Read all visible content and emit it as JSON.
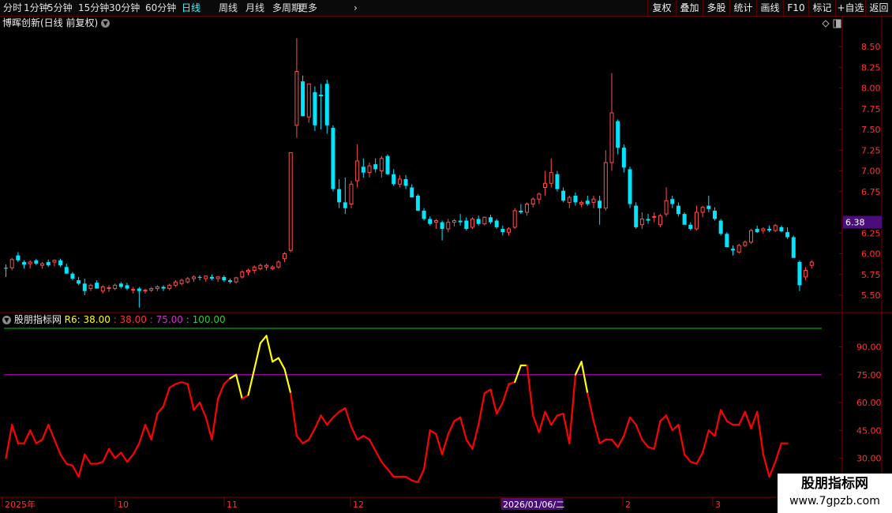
{
  "toolbar": {
    "periods": [
      "分时",
      "1分钟",
      "5分钟",
      "15分钟",
      "30分钟",
      "60分钟",
      "日线",
      "周线",
      "月线",
      "多周期",
      "更多"
    ],
    "active_period": "日线",
    "actions": [
      "复权",
      "叠加",
      "多股",
      "统计",
      "画线",
      "F10",
      "标记",
      "+自选",
      "返回"
    ]
  },
  "main_chart": {
    "title": "博晖创新(日线 前复权)",
    "price_ticks": [
      "8.50",
      "8.25",
      "8.00",
      "7.75",
      "7.50",
      "7.25",
      "7.00",
      "6.75",
      "6.25",
      "6.00",
      "5.75",
      "5.50"
    ],
    "current_price_label": "6.38"
  },
  "indicator": {
    "name": "股朋指标网",
    "params": [
      "R6: 38.00",
      ": 38.00",
      ": 75.00",
      ": 100.00"
    ],
    "ticks": [
      "90.00",
      "75.00",
      "60.00",
      "45.00",
      "30.00"
    ]
  },
  "time_axis": {
    "labels": [
      "2025年",
      "10",
      "11",
      "12",
      "2026/01/06/二",
      "2",
      "3"
    ]
  },
  "brand": {
    "line1": "股朋指标网",
    "line2": "www.7gpzb.com"
  },
  "colors": {
    "up": "#ff4d4d",
    "down": "#00e5ff",
    "indicator_line": "#ff0000",
    "indicator_high": "#ffff00",
    "line_100": "#00cc00",
    "line_75": "#cc00cc",
    "grid_border": "#800000"
  },
  "chart_data": {
    "type": "candlestick",
    "ohlc": [
      [
        5.83,
        5.87,
        5.72,
        5.82
      ],
      [
        5.83,
        5.95,
        5.8,
        5.93
      ],
      [
        5.98,
        6.02,
        5.9,
        5.92
      ],
      [
        5.9,
        5.92,
        5.82,
        5.87
      ],
      [
        5.88,
        5.92,
        5.82,
        5.9
      ],
      [
        5.92,
        5.94,
        5.86,
        5.88
      ],
      [
        5.86,
        5.9,
        5.82,
        5.88
      ],
      [
        5.9,
        5.93,
        5.84,
        5.86
      ],
      [
        5.9,
        5.93,
        5.85,
        5.92
      ],
      [
        5.92,
        5.94,
        5.84,
        5.86
      ],
      [
        5.84,
        5.88,
        5.76,
        5.76
      ],
      [
        5.76,
        5.78,
        5.68,
        5.7
      ],
      [
        5.68,
        5.72,
        5.62,
        5.64
      ],
      [
        5.64,
        5.7,
        5.5,
        5.55
      ],
      [
        5.58,
        5.64,
        5.55,
        5.62
      ],
      [
        5.65,
        5.68,
        5.58,
        5.58
      ],
      [
        5.55,
        5.62,
        5.52,
        5.6
      ],
      [
        5.58,
        5.62,
        5.54,
        5.59
      ],
      [
        5.58,
        5.64,
        5.56,
        5.62
      ],
      [
        5.64,
        5.66,
        5.58,
        5.6
      ],
      [
        5.62,
        5.65,
        5.56,
        5.58
      ],
      [
        5.56,
        5.6,
        5.52,
        5.57
      ],
      [
        5.58,
        5.6,
        5.35,
        5.55
      ],
      [
        5.55,
        5.58,
        5.52,
        5.56
      ],
      [
        5.56,
        5.6,
        5.54,
        5.58
      ],
      [
        5.58,
        5.62,
        5.55,
        5.6
      ],
      [
        5.6,
        5.62,
        5.55,
        5.58
      ],
      [
        5.58,
        5.64,
        5.56,
        5.62
      ],
      [
        5.62,
        5.68,
        5.6,
        5.66
      ],
      [
        5.64,
        5.7,
        5.62,
        5.68
      ],
      [
        5.66,
        5.72,
        5.64,
        5.7
      ],
      [
        5.7,
        5.74,
        5.66,
        5.72
      ],
      [
        5.72,
        5.74,
        5.68,
        5.71
      ],
      [
        5.7,
        5.74,
        5.66,
        5.73
      ],
      [
        5.72,
        5.75,
        5.68,
        5.7
      ],
      [
        5.7,
        5.73,
        5.66,
        5.72
      ],
      [
        5.72,
        5.74,
        5.66,
        5.68
      ],
      [
        5.68,
        5.7,
        5.64,
        5.66
      ],
      [
        5.66,
        5.72,
        5.64,
        5.71
      ],
      [
        5.72,
        5.8,
        5.7,
        5.78
      ],
      [
        5.78,
        5.82,
        5.74,
        5.8
      ],
      [
        5.8,
        5.86,
        5.76,
        5.84
      ],
      [
        5.82,
        5.88,
        5.8,
        5.86
      ],
      [
        5.84,
        5.88,
        5.8,
        5.86
      ],
      [
        5.82,
        5.86,
        5.8,
        5.84
      ],
      [
        5.84,
        5.92,
        5.82,
        5.9
      ],
      [
        5.94,
        6.02,
        5.9,
        6.0
      ],
      [
        6.04,
        7.22,
        6.02,
        7.22
      ],
      [
        7.55,
        8.6,
        7.4,
        8.2
      ],
      [
        8.08,
        8.15,
        7.66,
        7.66
      ],
      [
        7.65,
        8.05,
        7.58,
        8.05
      ],
      [
        7.95,
        8.02,
        7.48,
        7.55
      ],
      [
        7.92,
        8.05,
        7.5,
        7.9
      ],
      [
        8.05,
        8.1,
        7.45,
        7.55
      ],
      [
        7.52,
        7.55,
        6.75,
        6.78
      ],
      [
        6.78,
        6.9,
        6.55,
        6.62
      ],
      [
        6.62,
        6.92,
        6.48,
        6.55
      ],
      [
        6.6,
        6.88,
        6.55,
        6.84
      ],
      [
        6.88,
        7.32,
        6.8,
        7.12
      ],
      [
        7.05,
        7.15,
        6.92,
        6.98
      ],
      [
        6.98,
        7.1,
        6.92,
        7.06
      ],
      [
        7.08,
        7.15,
        6.98,
        7.02
      ],
      [
        7.0,
        7.18,
        6.92,
        7.15
      ],
      [
        7.18,
        7.2,
        6.95,
        6.96
      ],
      [
        6.96,
        7.02,
        6.82,
        6.84
      ],
      [
        6.84,
        6.95,
        6.8,
        6.9
      ],
      [
        6.9,
        6.95,
        6.78,
        6.82
      ],
      [
        6.8,
        6.84,
        6.68,
        6.68
      ],
      [
        6.7,
        6.72,
        6.52,
        6.52
      ],
      [
        6.52,
        6.55,
        6.4,
        6.42
      ],
      [
        6.42,
        6.45,
        6.34,
        6.36
      ],
      [
        6.38,
        6.42,
        6.3,
        6.4
      ],
      [
        6.38,
        6.4,
        6.16,
        6.3
      ],
      [
        6.3,
        6.42,
        6.26,
        6.38
      ],
      [
        6.38,
        6.42,
        6.33,
        6.4
      ],
      [
        6.4,
        6.48,
        6.34,
        6.38
      ],
      [
        6.4,
        6.44,
        6.28,
        6.3
      ],
      [
        6.32,
        6.44,
        6.3,
        6.42
      ],
      [
        6.42,
        6.46,
        6.34,
        6.36
      ],
      [
        6.36,
        6.45,
        6.34,
        6.44
      ],
      [
        6.44,
        6.47,
        6.36,
        6.38
      ],
      [
        6.4,
        6.42,
        6.3,
        6.32
      ],
      [
        6.3,
        6.34,
        6.22,
        6.26
      ],
      [
        6.26,
        6.32,
        6.22,
        6.3
      ],
      [
        6.32,
        6.55,
        6.3,
        6.52
      ],
      [
        6.52,
        6.6,
        6.48,
        6.5
      ],
      [
        6.5,
        6.62,
        6.46,
        6.6
      ],
      [
        6.6,
        6.68,
        6.56,
        6.66
      ],
      [
        6.66,
        6.74,
        6.6,
        6.72
      ],
      [
        6.8,
        7.0,
        6.7,
        6.85
      ],
      [
        6.85,
        7.15,
        6.8,
        6.98
      ],
      [
        6.96,
        7.0,
        6.75,
        6.78
      ],
      [
        6.76,
        6.8,
        6.62,
        6.64
      ],
      [
        6.62,
        6.7,
        6.55,
        6.68
      ],
      [
        6.7,
        6.74,
        6.58,
        6.62
      ],
      [
        6.6,
        6.64,
        6.56,
        6.62
      ],
      [
        6.64,
        6.7,
        6.58,
        6.6
      ],
      [
        6.62,
        6.7,
        6.55,
        6.66
      ],
      [
        6.64,
        6.7,
        6.35,
        6.55
      ],
      [
        6.55,
        7.25,
        6.52,
        7.1
      ],
      [
        7.1,
        8.18,
        7.0,
        7.7
      ],
      [
        7.6,
        7.62,
        7.2,
        7.28
      ],
      [
        7.28,
        7.32,
        6.98,
        7.04
      ],
      [
        7.02,
        7.05,
        6.55,
        6.6
      ],
      [
        6.58,
        6.62,
        6.3,
        6.32
      ],
      [
        6.35,
        6.5,
        6.3,
        6.42
      ],
      [
        6.42,
        6.48,
        6.36,
        6.4
      ],
      [
        6.44,
        6.5,
        6.38,
        6.45
      ],
      [
        6.35,
        6.48,
        6.32,
        6.46
      ],
      [
        6.48,
        6.8,
        6.45,
        6.64
      ],
      [
        6.66,
        6.7,
        6.55,
        6.6
      ],
      [
        6.58,
        6.62,
        6.45,
        6.48
      ],
      [
        6.48,
        6.5,
        6.35,
        6.35
      ],
      [
        6.35,
        6.38,
        6.28,
        6.3
      ],
      [
        6.3,
        6.58,
        6.28,
        6.5
      ],
      [
        6.5,
        6.58,
        6.44,
        6.56
      ],
      [
        6.58,
        6.7,
        6.5,
        6.54
      ],
      [
        6.52,
        6.56,
        6.4,
        6.42
      ],
      [
        6.4,
        6.42,
        6.22,
        6.24
      ],
      [
        6.24,
        6.26,
        6.08,
        6.08
      ],
      [
        6.06,
        6.1,
        5.98,
        6.04
      ],
      [
        6.02,
        6.12,
        6.0,
        6.1
      ],
      [
        6.1,
        6.16,
        6.08,
        6.14
      ],
      [
        6.14,
        6.3,
        6.12,
        6.28
      ],
      [
        6.3,
        6.34,
        6.25,
        6.26
      ],
      [
        6.28,
        6.32,
        6.24,
        6.3
      ],
      [
        6.3,
        6.34,
        6.26,
        6.28
      ],
      [
        6.28,
        6.36,
        6.26,
        6.34
      ],
      [
        6.32,
        6.34,
        6.26,
        6.27
      ],
      [
        6.26,
        6.32,
        6.18,
        6.2
      ],
      [
        6.2,
        6.22,
        5.95,
        5.95
      ],
      [
        5.9,
        5.92,
        5.55,
        5.62
      ],
      [
        5.72,
        5.84,
        5.68,
        5.8
      ],
      [
        5.86,
        5.92,
        5.82,
        5.9
      ]
    ],
    "indicator_values": [
      30,
      48,
      38,
      38,
      45,
      38,
      40,
      48,
      40,
      32,
      27,
      26,
      20,
      32,
      27,
      27,
      28,
      35,
      30,
      33,
      28,
      32,
      38,
      48,
      40,
      54,
      58,
      68,
      70,
      71,
      70,
      56,
      60,
      52,
      40,
      62,
      70,
      73,
      75,
      62,
      64,
      78,
      92,
      96,
      82,
      84,
      78,
      65,
      42,
      38,
      40,
      46,
      53,
      48,
      52,
      55,
      57,
      47,
      40,
      42,
      40,
      34,
      28,
      24,
      20,
      20,
      20,
      18,
      17,
      24,
      45,
      43,
      32,
      43,
      50,
      52,
      40,
      35,
      48,
      65,
      67,
      54,
      60,
      70,
      71,
      80,
      80,
      53,
      44,
      55,
      48,
      53,
      54,
      38,
      75,
      82,
      65,
      50,
      38,
      40,
      40,
      36,
      42,
      52,
      48,
      40,
      36,
      35,
      50,
      53,
      45,
      48,
      32,
      28,
      27,
      33,
      45,
      42,
      56,
      50,
      48,
      48,
      55,
      46,
      55,
      32,
      20,
      28,
      38,
      38
    ],
    "high_threshold": 75,
    "reference_lines": [
      100,
      75
    ],
    "yrange_price": [
      5.3,
      8.7
    ],
    "yrange_indicator": [
      20,
      100
    ]
  }
}
